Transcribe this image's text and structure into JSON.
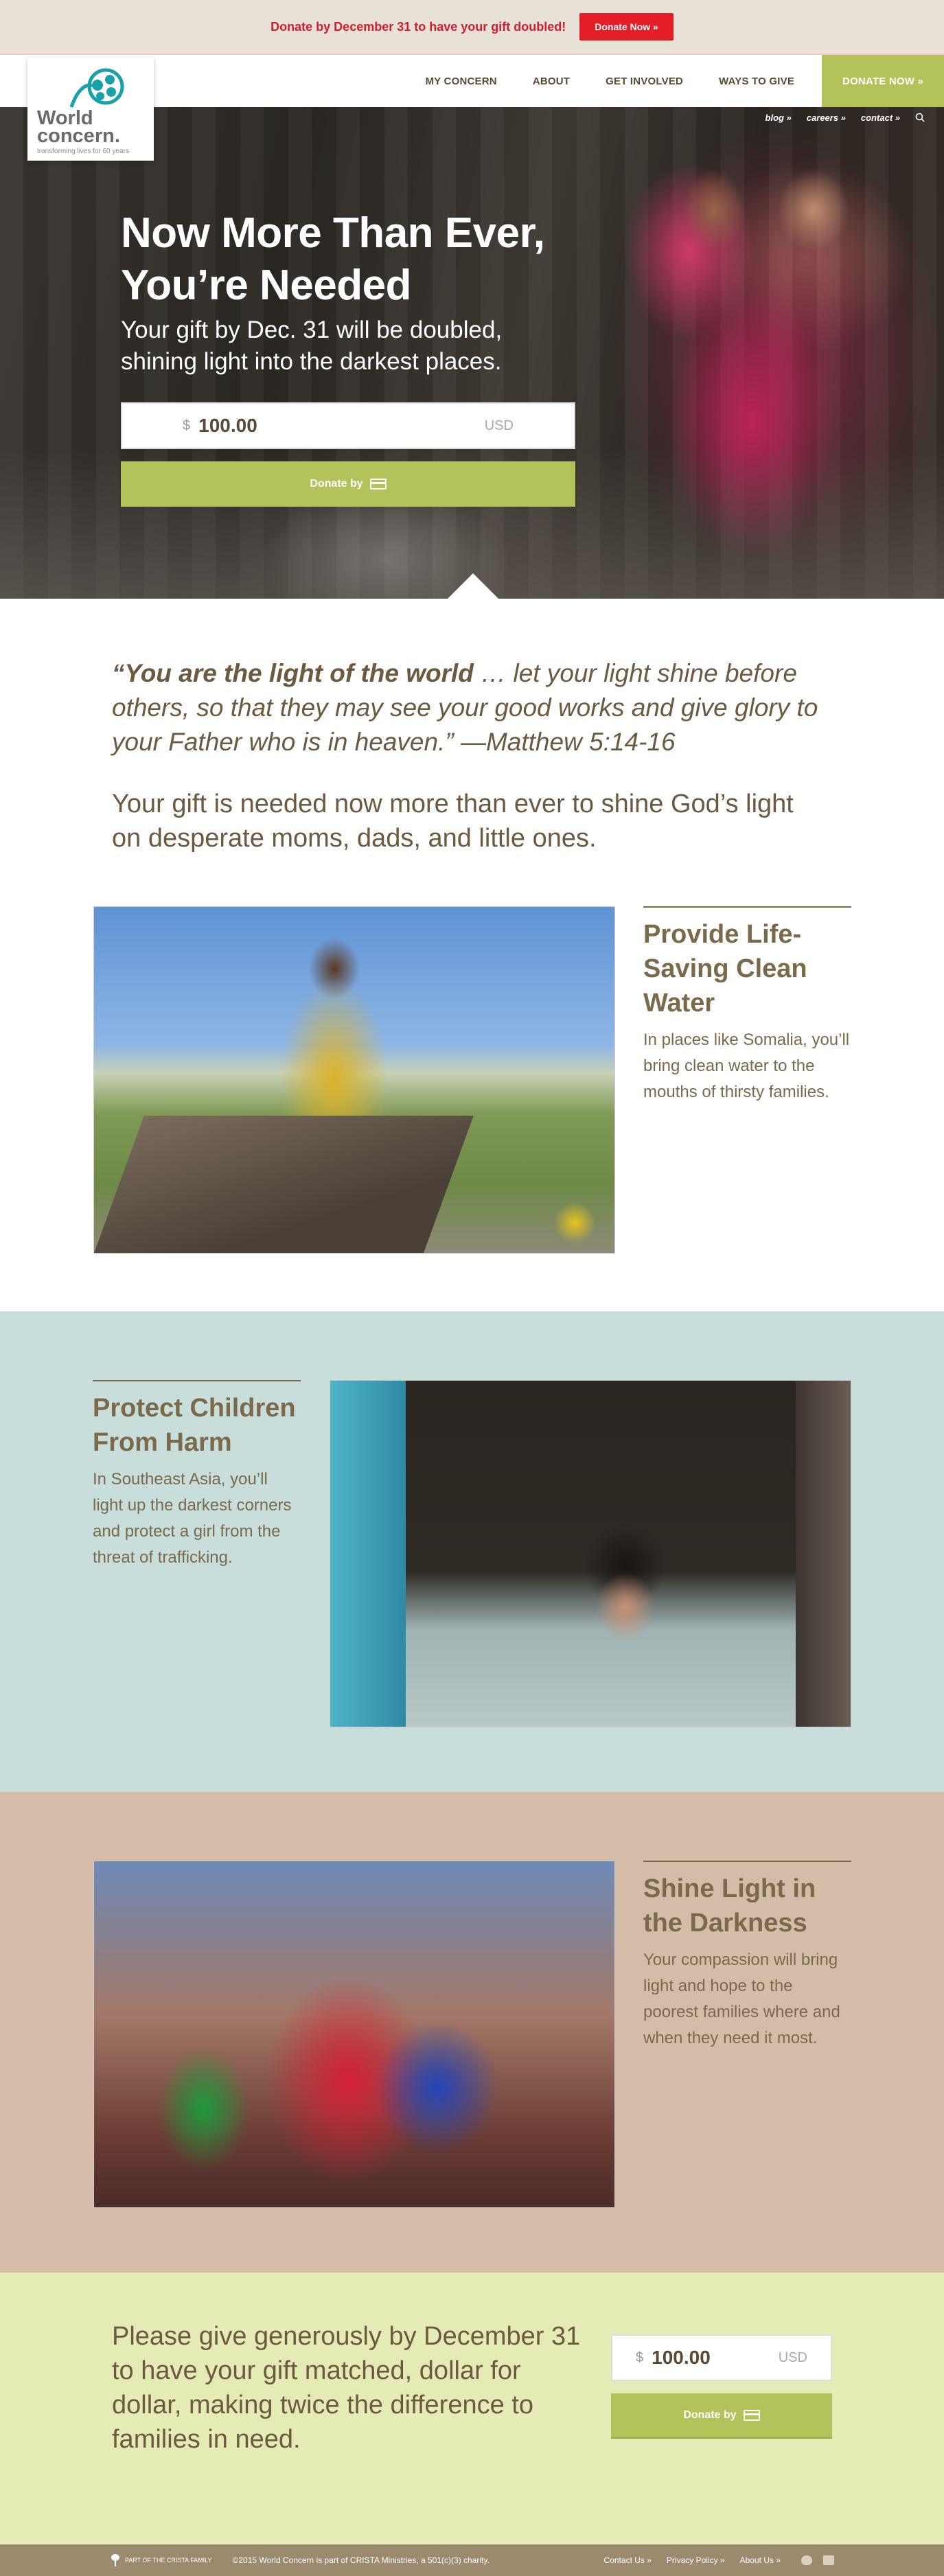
{
  "promo": {
    "text": "Donate by December 31 to have your gift doubled!",
    "button": "Donate Now »"
  },
  "brand": {
    "name_line1": "World",
    "name_line2": "concern.",
    "tagline": "transforming lives for 60 years",
    "accent_color": "#b3c35a",
    "promo_color": "#e41e26"
  },
  "nav": {
    "items": [
      "MY CONCERN",
      "ABOUT",
      "GET INVOLVED",
      "WAYS TO GIVE"
    ],
    "donate": "DONATE NOW »"
  },
  "utility": {
    "blog": "blog »",
    "careers": "careers »",
    "contact": "contact »",
    "search_icon": "search-icon"
  },
  "hero": {
    "title": "Now More Than Ever, You’re Needed",
    "subtitle": "Your gift by Dec. 31 will be doubled, shining light into the darkest places.",
    "currency": "$",
    "amount": "100.00",
    "unit": "USD",
    "donate_label": "Donate by",
    "donate_icon": "credit-card-icon"
  },
  "intro": {
    "quote_bold": "“You are the light of the world",
    "quote_rest": " … let your light shine before others, so that they may see your good works and give glory to your Father who is in heaven.” —Matthew 5:14-16",
    "lead": "Your gift is needed now more than ever to shine God’s light on desperate moms, dads, and little ones."
  },
  "features": [
    {
      "title": "Provide Life-Saving Clean Water",
      "body": "In places like Somalia, you’ll bring clean water to the mouths of thirsty families."
    },
    {
      "title": "Protect Children From Harm",
      "body": "In Southeast Asia, you’ll light up the darkest corners and protect a girl from the threat of trafficking."
    },
    {
      "title": "Shine Light in the Darkness",
      "body": "Your compassion will bring light and hope to the poorest families where and when they need it most."
    }
  ],
  "closing": {
    "text": "Please give generously by December 31 to have your gift matched, dollar for dollar, making twice the difference to families in need.",
    "currency": "$",
    "amount": "100.00",
    "unit": "USD",
    "donate_label": "Donate by"
  },
  "footer": {
    "crista": "PART OF THE CRISTA FAMILY",
    "copyright": "©2015 World Concern is part of CRISTA Ministries, a 501(c)(3) charity.",
    "links": [
      "Contact Us »",
      "Privacy Policy »",
      "About Us »"
    ]
  }
}
